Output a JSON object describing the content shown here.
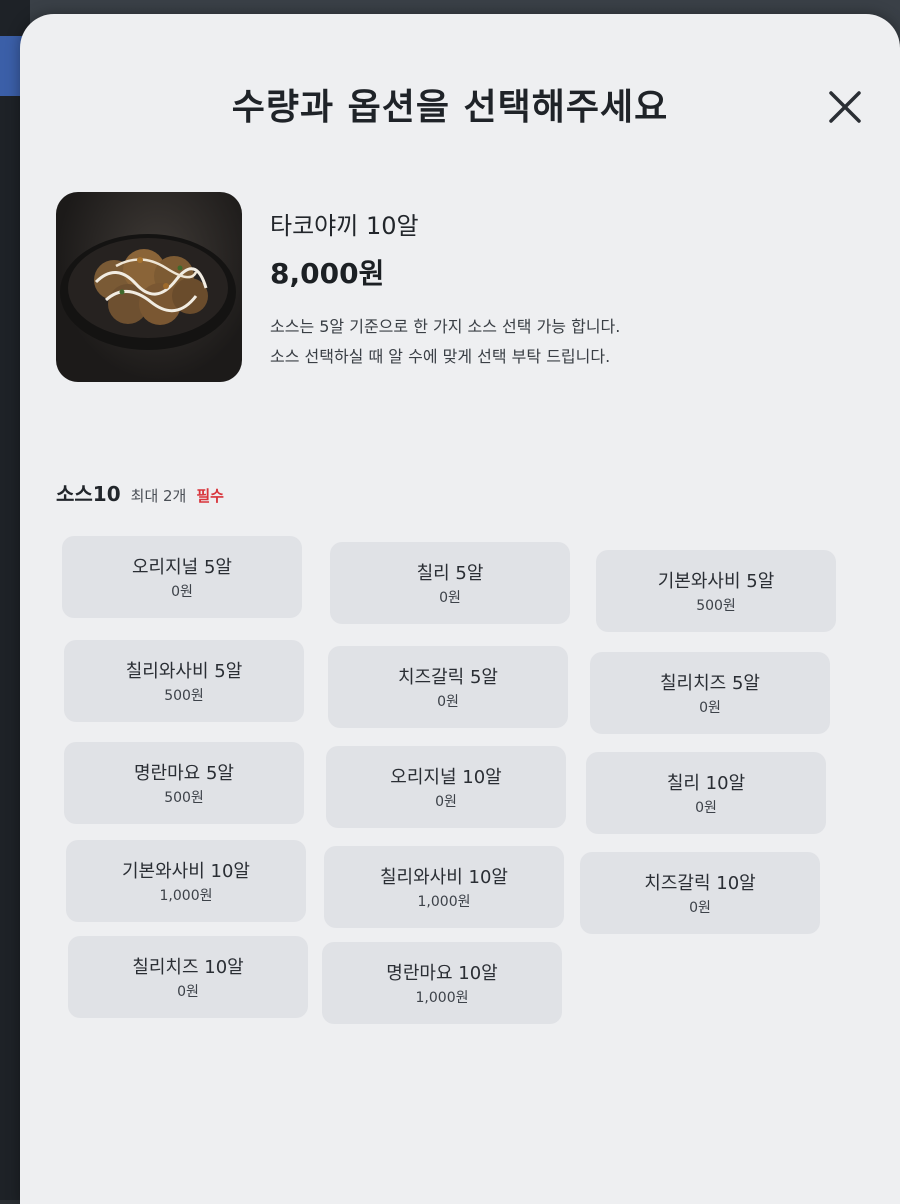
{
  "modal": {
    "title": "수량과 옵션을 선택해주세요"
  },
  "product": {
    "name": "타코야끼 10알",
    "price": "8,000원",
    "desc_line1": "소스는 5알 기준으로 한 가지 소스 선택 가능 합니다.",
    "desc_line2": "소스 선택하실 때 알 수에 맞게 선택 부탁 드립니다."
  },
  "option_group": {
    "title": "소스10",
    "max": "최대 2개",
    "required": "필수",
    "options": [
      {
        "name": "오리지널 5알",
        "price": "0원"
      },
      {
        "name": "칠리 5알",
        "price": "0원"
      },
      {
        "name": "기본와사비 5알",
        "price": "500원"
      },
      {
        "name": "칠리와사비 5알",
        "price": "500원"
      },
      {
        "name": "치즈갈릭 5알",
        "price": "0원"
      },
      {
        "name": "칠리치즈 5알",
        "price": "0원"
      },
      {
        "name": "명란마요 5알",
        "price": "500원"
      },
      {
        "name": "오리지널 10알",
        "price": "0원"
      },
      {
        "name": "칠리 10알",
        "price": "0원"
      },
      {
        "name": "기본와사비 10알",
        "price": "1,000원"
      },
      {
        "name": "칠리와사비 10알",
        "price": "1,000원"
      },
      {
        "name": "치즈갈릭 10알",
        "price": "0원"
      },
      {
        "name": "칠리치즈 10알",
        "price": "0원"
      },
      {
        "name": "명란마요 10알",
        "price": "1,000원"
      }
    ]
  },
  "icons": {
    "close": "close-icon",
    "product_image": "takoyaki-image"
  },
  "colors": {
    "required": "#d8343b",
    "option_bg": "#e0e2e6",
    "modal_bg": "#eeeff1"
  }
}
